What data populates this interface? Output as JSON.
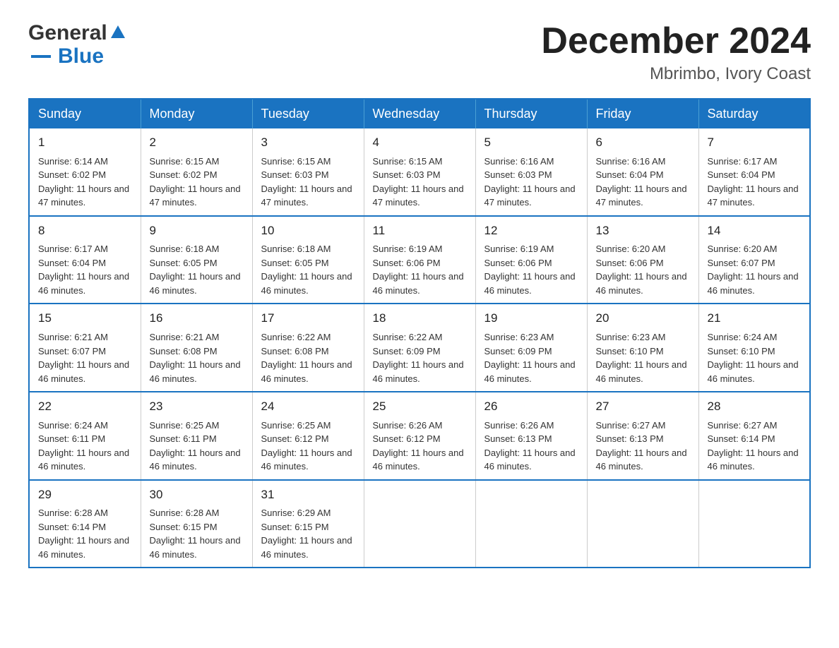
{
  "header": {
    "logo_general": "General",
    "logo_blue": "Blue",
    "month_title": "December 2024",
    "location": "Mbrimbo, Ivory Coast"
  },
  "days_of_week": [
    "Sunday",
    "Monday",
    "Tuesday",
    "Wednesday",
    "Thursday",
    "Friday",
    "Saturday"
  ],
  "weeks": [
    [
      {
        "day": "1",
        "sunrise": "6:14 AM",
        "sunset": "6:02 PM",
        "daylight": "11 hours and 47 minutes."
      },
      {
        "day": "2",
        "sunrise": "6:15 AM",
        "sunset": "6:02 PM",
        "daylight": "11 hours and 47 minutes."
      },
      {
        "day": "3",
        "sunrise": "6:15 AM",
        "sunset": "6:03 PM",
        "daylight": "11 hours and 47 minutes."
      },
      {
        "day": "4",
        "sunrise": "6:15 AM",
        "sunset": "6:03 PM",
        "daylight": "11 hours and 47 minutes."
      },
      {
        "day": "5",
        "sunrise": "6:16 AM",
        "sunset": "6:03 PM",
        "daylight": "11 hours and 47 minutes."
      },
      {
        "day": "6",
        "sunrise": "6:16 AM",
        "sunset": "6:04 PM",
        "daylight": "11 hours and 47 minutes."
      },
      {
        "day": "7",
        "sunrise": "6:17 AM",
        "sunset": "6:04 PM",
        "daylight": "11 hours and 47 minutes."
      }
    ],
    [
      {
        "day": "8",
        "sunrise": "6:17 AM",
        "sunset": "6:04 PM",
        "daylight": "11 hours and 46 minutes."
      },
      {
        "day": "9",
        "sunrise": "6:18 AM",
        "sunset": "6:05 PM",
        "daylight": "11 hours and 46 minutes."
      },
      {
        "day": "10",
        "sunrise": "6:18 AM",
        "sunset": "6:05 PM",
        "daylight": "11 hours and 46 minutes."
      },
      {
        "day": "11",
        "sunrise": "6:19 AM",
        "sunset": "6:06 PM",
        "daylight": "11 hours and 46 minutes."
      },
      {
        "day": "12",
        "sunrise": "6:19 AM",
        "sunset": "6:06 PM",
        "daylight": "11 hours and 46 minutes."
      },
      {
        "day": "13",
        "sunrise": "6:20 AM",
        "sunset": "6:06 PM",
        "daylight": "11 hours and 46 minutes."
      },
      {
        "day": "14",
        "sunrise": "6:20 AM",
        "sunset": "6:07 PM",
        "daylight": "11 hours and 46 minutes."
      }
    ],
    [
      {
        "day": "15",
        "sunrise": "6:21 AM",
        "sunset": "6:07 PM",
        "daylight": "11 hours and 46 minutes."
      },
      {
        "day": "16",
        "sunrise": "6:21 AM",
        "sunset": "6:08 PM",
        "daylight": "11 hours and 46 minutes."
      },
      {
        "day": "17",
        "sunrise": "6:22 AM",
        "sunset": "6:08 PM",
        "daylight": "11 hours and 46 minutes."
      },
      {
        "day": "18",
        "sunrise": "6:22 AM",
        "sunset": "6:09 PM",
        "daylight": "11 hours and 46 minutes."
      },
      {
        "day": "19",
        "sunrise": "6:23 AM",
        "sunset": "6:09 PM",
        "daylight": "11 hours and 46 minutes."
      },
      {
        "day": "20",
        "sunrise": "6:23 AM",
        "sunset": "6:10 PM",
        "daylight": "11 hours and 46 minutes."
      },
      {
        "day": "21",
        "sunrise": "6:24 AM",
        "sunset": "6:10 PM",
        "daylight": "11 hours and 46 minutes."
      }
    ],
    [
      {
        "day": "22",
        "sunrise": "6:24 AM",
        "sunset": "6:11 PM",
        "daylight": "11 hours and 46 minutes."
      },
      {
        "day": "23",
        "sunrise": "6:25 AM",
        "sunset": "6:11 PM",
        "daylight": "11 hours and 46 minutes."
      },
      {
        "day": "24",
        "sunrise": "6:25 AM",
        "sunset": "6:12 PM",
        "daylight": "11 hours and 46 minutes."
      },
      {
        "day": "25",
        "sunrise": "6:26 AM",
        "sunset": "6:12 PM",
        "daylight": "11 hours and 46 minutes."
      },
      {
        "day": "26",
        "sunrise": "6:26 AM",
        "sunset": "6:13 PM",
        "daylight": "11 hours and 46 minutes."
      },
      {
        "day": "27",
        "sunrise": "6:27 AM",
        "sunset": "6:13 PM",
        "daylight": "11 hours and 46 minutes."
      },
      {
        "day": "28",
        "sunrise": "6:27 AM",
        "sunset": "6:14 PM",
        "daylight": "11 hours and 46 minutes."
      }
    ],
    [
      {
        "day": "29",
        "sunrise": "6:28 AM",
        "sunset": "6:14 PM",
        "daylight": "11 hours and 46 minutes."
      },
      {
        "day": "30",
        "sunrise": "6:28 AM",
        "sunset": "6:15 PM",
        "daylight": "11 hours and 46 minutes."
      },
      {
        "day": "31",
        "sunrise": "6:29 AM",
        "sunset": "6:15 PM",
        "daylight": "11 hours and 46 minutes."
      },
      null,
      null,
      null,
      null
    ]
  ]
}
